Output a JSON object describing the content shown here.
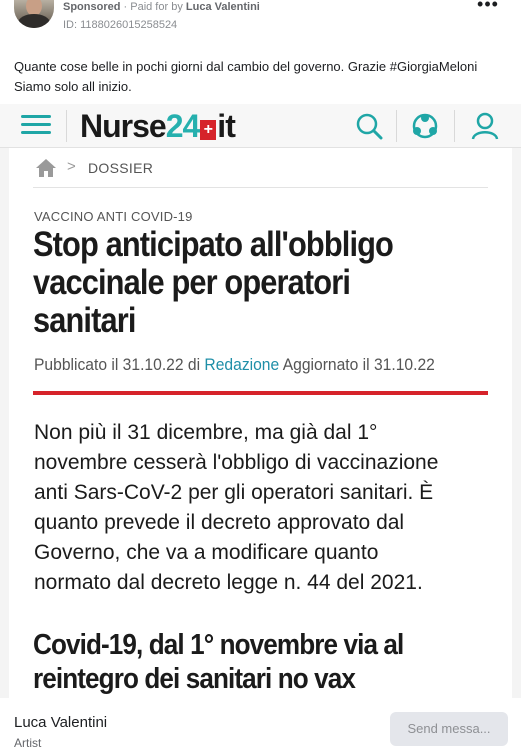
{
  "ad": {
    "sponsored": "Sponsored",
    "separator": " · ",
    "paid_for_by": "Paid for by",
    "advertiser": "Luca Valentini",
    "id_line": "ID: 1188026015258524",
    "more_icon": "more-horizontal-icon",
    "caption": "Quante cose belle in pochi giorni dal cambio del governo. Grazie #GiorgiaMeloni Siamo solo all inizio."
  },
  "site": {
    "logo_part1": "Nurse",
    "logo_part2": "24",
    "logo_plus": "+",
    "logo_part3": "it",
    "icons": [
      "menu-icon",
      "search-icon",
      "community-icon",
      "user-icon"
    ],
    "brand_color": "#26b0ae",
    "accent_color": "#d6232a"
  },
  "article": {
    "breadcrumb_separator": ">",
    "breadcrumb": "DOSSIER",
    "kicker": "VACCINO ANTI COVID-19",
    "headline": "Stop anticipato all'obbligo\nvaccinale per operatori\nsanitari",
    "byline_prefix": "Pubblicato il 31.10.22 di ",
    "byline_author": "Redazione",
    "byline_suffix": " Aggiornato il 31.10.22",
    "body": "Non più il 31 dicembre, ma già dal 1°\nnovembre cesserà l'obbligo di vaccinazione\nanti Sars-CoV-2 per gli operatori sanitari. È\nquanto prevede il decreto approvato dal\nGoverno, che va a modificare quanto\nnormato dal decreto legge n. 44 del 2021.",
    "subheading": "Covid-19, dal 1° novembre via al\nreintegro dei sanitari no vax"
  },
  "footer": {
    "page_name": "Luca Valentini",
    "category": "Artist",
    "send_label": "Send messa..."
  }
}
